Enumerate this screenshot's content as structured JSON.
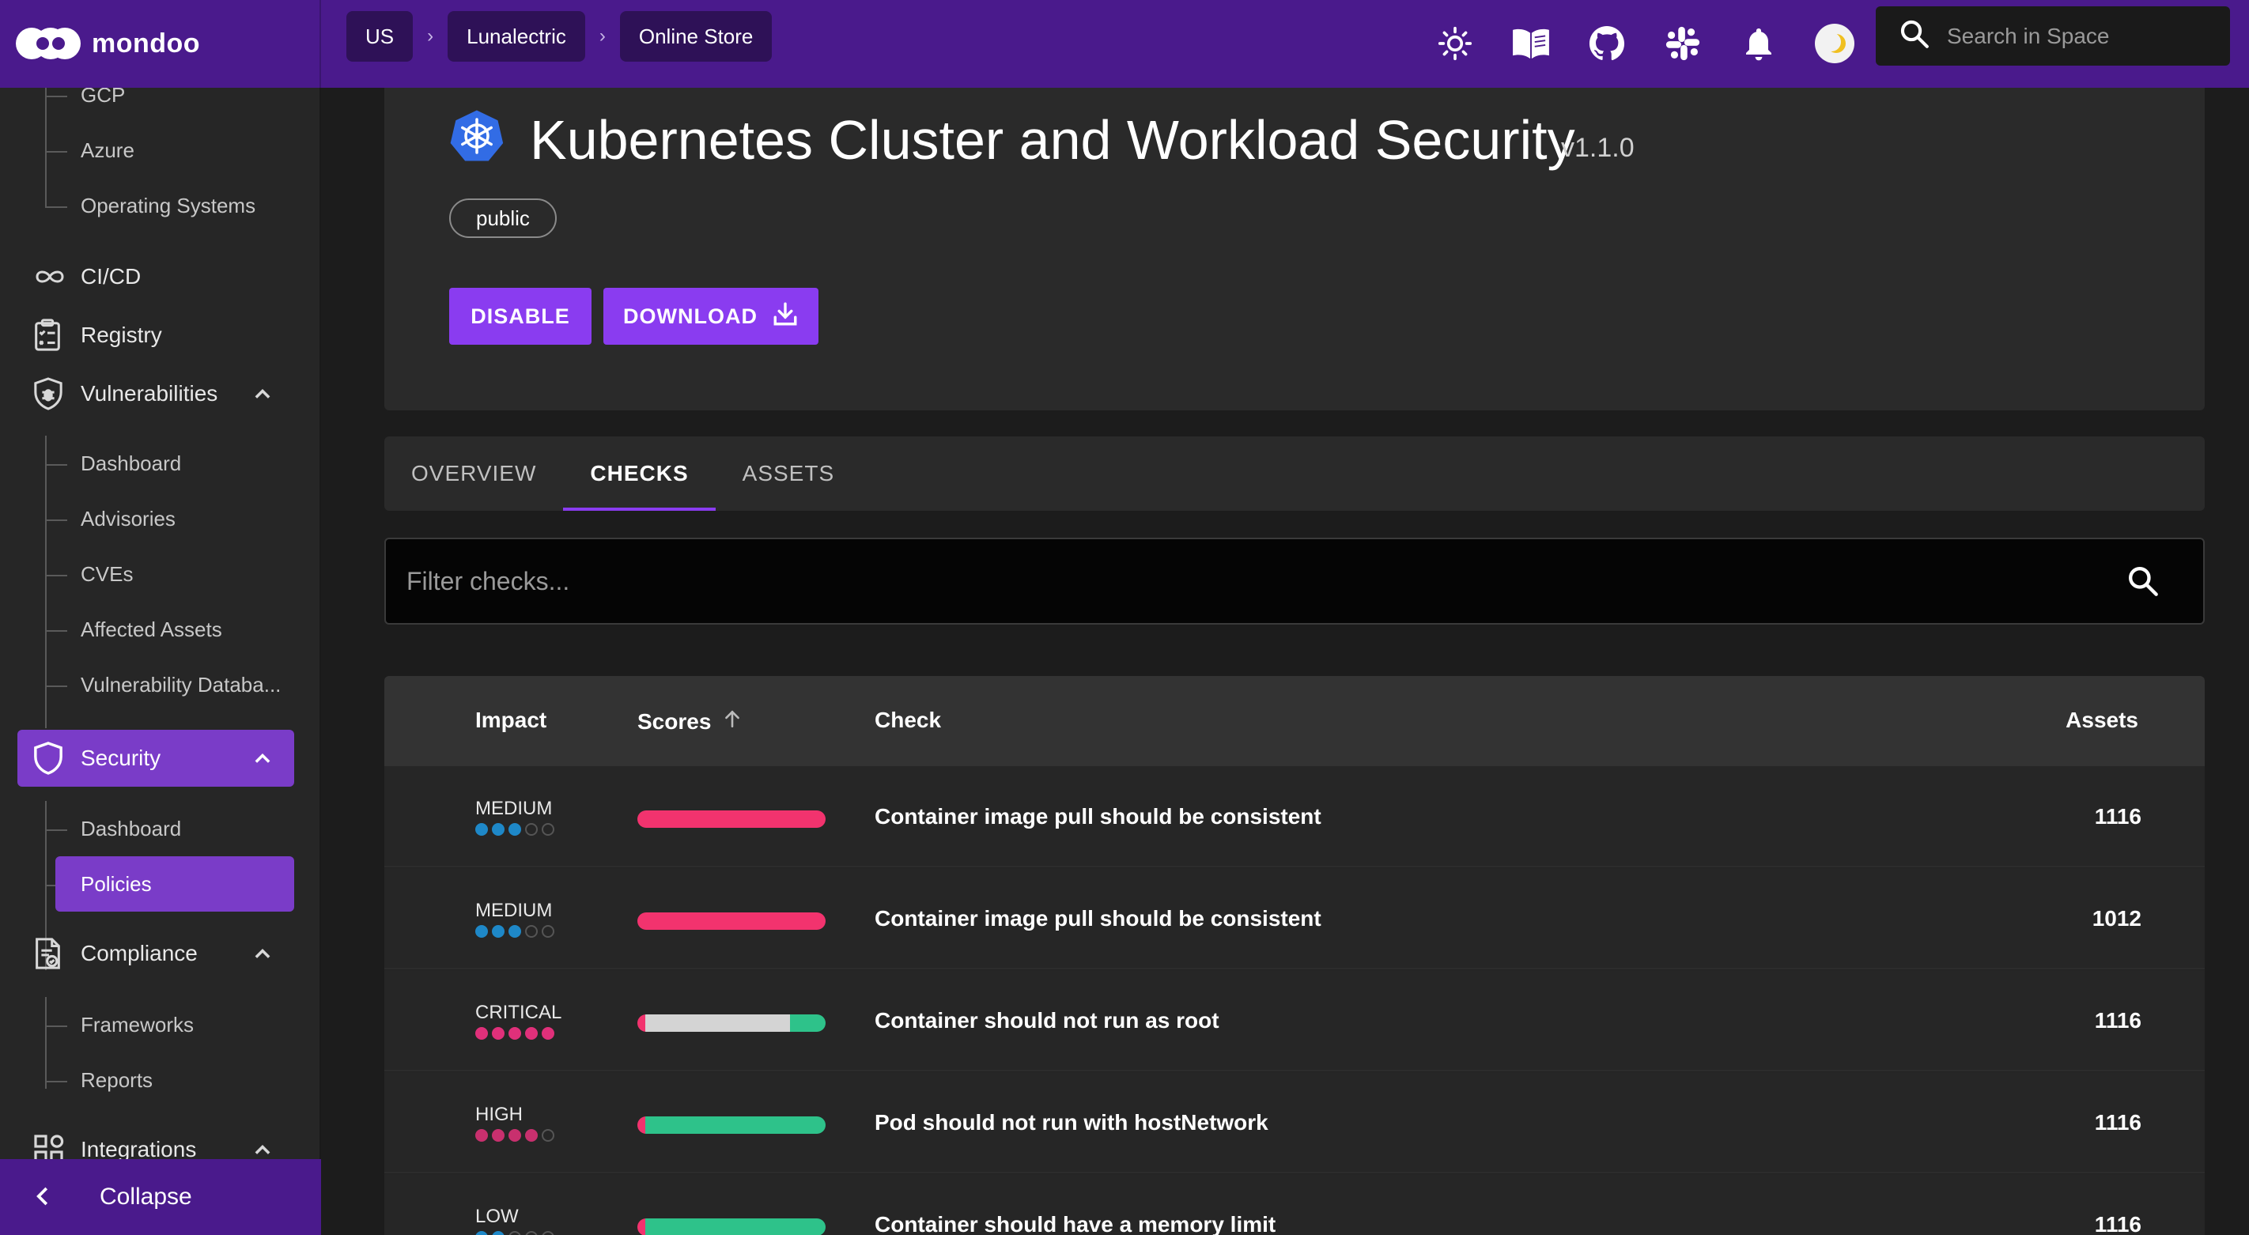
{
  "app": {
    "name": "mondoo"
  },
  "breadcrumbs": [
    "US",
    "Lunalectric",
    "Online Store"
  ],
  "search": {
    "placeholder": "Search in Space"
  },
  "sidebar": {
    "cloud_sub_items": [
      "GCP",
      "Azure",
      "Operating Systems"
    ],
    "cicd_label": "CI/CD",
    "registry_label": "Registry",
    "vulnerabilities": {
      "label": "Vulnerabilities",
      "items": [
        "Dashboard",
        "Advisories",
        "CVEs",
        "Affected Assets",
        "Vulnerability Databa..."
      ]
    },
    "security": {
      "label": "Security",
      "items": [
        "Dashboard",
        "Policies"
      ]
    },
    "compliance": {
      "label": "Compliance",
      "items": [
        "Frameworks",
        "Reports"
      ]
    },
    "integrations_label": "Integrations",
    "collapse_label": "Collapse"
  },
  "policy": {
    "title": "Kubernetes Cluster and Workload Security",
    "version": "v1.1.0",
    "tag": "public",
    "disable_label": "DISABLE",
    "download_label": "DOWNLOAD"
  },
  "tabs": [
    "OVERVIEW",
    "CHECKS",
    "ASSETS"
  ],
  "active_tab": "CHECKS",
  "filter": {
    "placeholder": "Filter checks..."
  },
  "table": {
    "headers": {
      "impact": "Impact",
      "scores": "Scores",
      "check": "Check",
      "assets": "Assets"
    },
    "rows": [
      {
        "impact": "MEDIUM",
        "impact_level": 3,
        "impact_color": "#1e88c8",
        "score": {
          "red": 1.0,
          "gray": 0.0,
          "green": 0.0
        },
        "check": "Container image pull should be consistent",
        "assets": "1116"
      },
      {
        "impact": "MEDIUM",
        "impact_level": 3,
        "impact_color": "#1e88c8",
        "score": {
          "red": 1.0,
          "gray": 0.0,
          "green": 0.0
        },
        "check": "Container image pull should be consistent",
        "assets": "1012"
      },
      {
        "impact": "CRITICAL",
        "impact_level": 5,
        "impact_color": "#e0307a",
        "score": {
          "red": 0.04,
          "gray": 0.77,
          "green": 0.19
        },
        "check": "Container should not run as root",
        "assets": "1116"
      },
      {
        "impact": "HIGH",
        "impact_level": 4,
        "impact_color": "#c8306e",
        "score": {
          "red": 0.04,
          "gray": 0.0,
          "green": 0.96
        },
        "check": "Pod should not run with hostNetwork",
        "assets": "1116"
      },
      {
        "impact": "LOW",
        "impact_level": 2,
        "impact_color": "#1e88c8",
        "score": {
          "red": 0.04,
          "gray": 0.0,
          "green": 0.96
        },
        "check": "Container should have a memory limit",
        "assets": "1116"
      }
    ]
  },
  "colors": {
    "topbar": "#4a1a8c",
    "accent": "#8a3cf0",
    "score_red": "#f2336e",
    "score_gray": "#d4d4d4",
    "score_green": "#2ec28a"
  }
}
